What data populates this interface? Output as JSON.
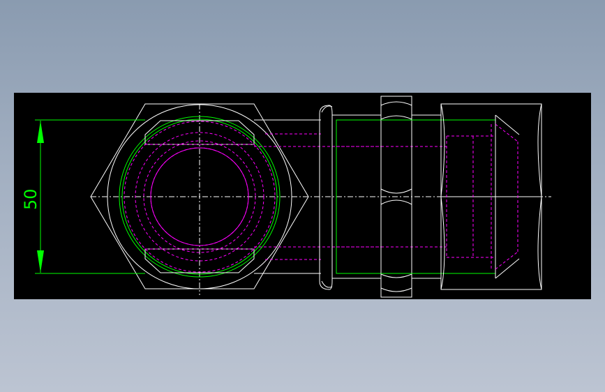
{
  "drawing": {
    "dimension_value": "50",
    "colors": {
      "background": "#000000",
      "outline": "#ffffff",
      "dimension": "#00ff00",
      "hidden": "#ff00ff"
    }
  }
}
